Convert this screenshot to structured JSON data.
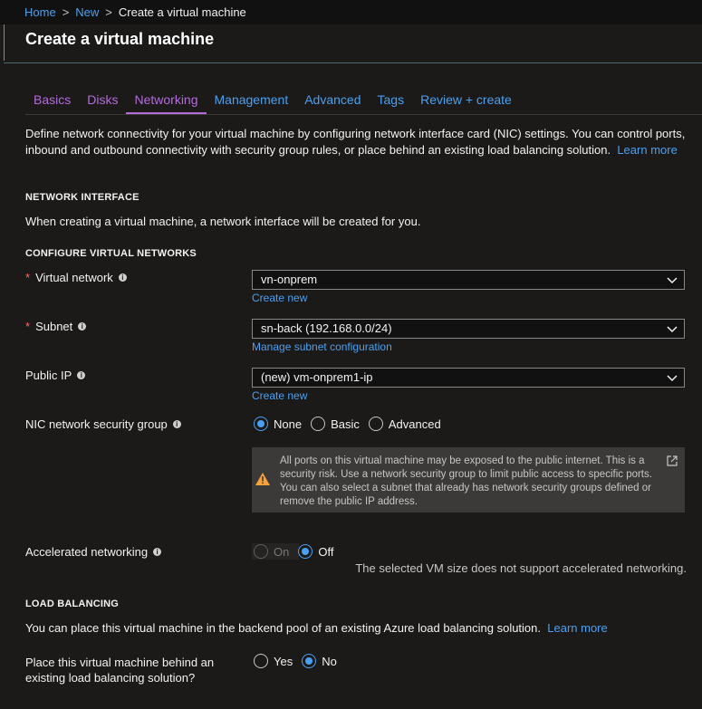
{
  "breadcrumb": {
    "home": "Home",
    "new": "New",
    "current": "Create a virtual machine",
    "sep": ">"
  },
  "page_title": "Create a virtual machine",
  "tabs": [
    {
      "label": "Basics"
    },
    {
      "label": "Disks"
    },
    {
      "label": "Networking"
    },
    {
      "label": "Management"
    },
    {
      "label": "Advanced"
    },
    {
      "label": "Tags"
    },
    {
      "label": "Review + create"
    }
  ],
  "description": {
    "text": "Define network connectivity for your virtual machine by configuring network interface card (NIC) settings. You can control ports, inbound and outbound connectivity with security group rules, or place behind an existing load balancing solution.",
    "learn_more": "Learn more"
  },
  "network_interface": {
    "heading": "NETWORK INTERFACE",
    "text": "When creating a virtual machine, a network interface will be created for you."
  },
  "configure_vnets": {
    "heading": "CONFIGURE VIRTUAL NETWORKS",
    "virtual_network": {
      "label": "Virtual network",
      "required": "*",
      "value": "vn-onprem",
      "link": "Create new"
    },
    "subnet": {
      "label": "Subnet",
      "required": "*",
      "value": "sn-back (192.168.0.0/24)",
      "link": "Manage subnet configuration"
    },
    "public_ip": {
      "label": "Public IP",
      "value": "(new) vm-onprem1-ip",
      "link": "Create new"
    },
    "nsg": {
      "label": "NIC network security group",
      "options": [
        "None",
        "Basic",
        "Advanced"
      ],
      "selected": "None"
    },
    "warning": "All ports on this virtual machine may be exposed to the public internet. This is a security risk. Use a network security group to limit public access to specific ports. You can also select a subnet that already has network security groups defined or remove the public IP address.",
    "accelerated": {
      "label": "Accelerated networking",
      "options": [
        "On",
        "Off"
      ],
      "selected": "Off",
      "note": "The selected VM size does not support accelerated networking."
    }
  },
  "load_balancing": {
    "heading": "LOAD BALANCING",
    "text": "You can place this virtual machine in the backend pool of an existing Azure load balancing solution.",
    "learn_more": "Learn more",
    "question_line1": "Place this virtual machine behind an",
    "question_line2": "existing load balancing solution?",
    "options": [
      "Yes",
      "No"
    ],
    "selected": "No"
  },
  "colors": {
    "accent": "#4aa0f0",
    "visited": "#b36bdc",
    "required": "#ff6a6a",
    "warning": "#f8a23a",
    "background": "#1b1a19"
  }
}
